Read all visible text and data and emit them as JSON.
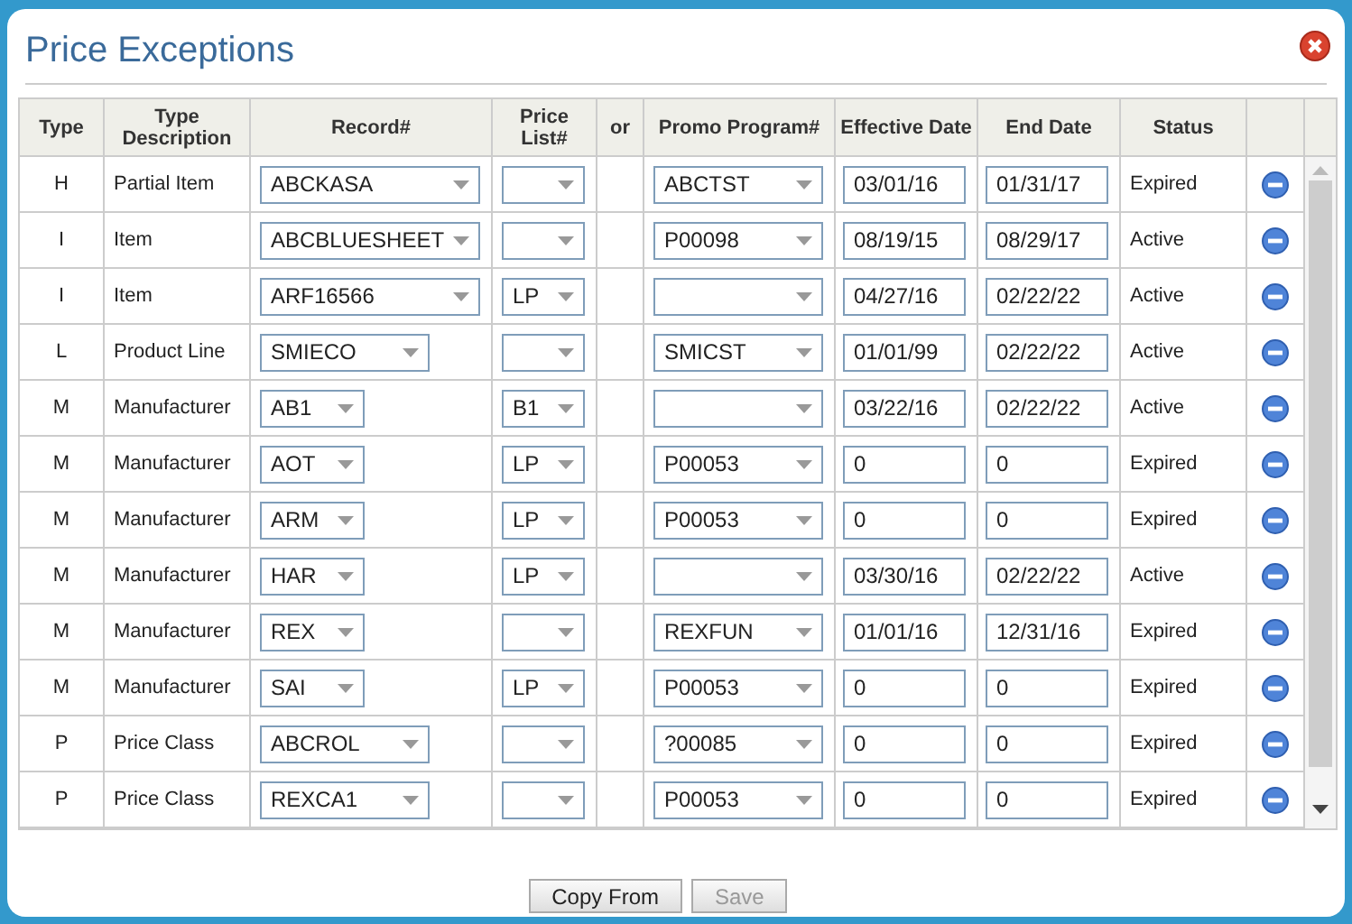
{
  "dialog": {
    "title": "Price Exceptions"
  },
  "table": {
    "columns": [
      "Type",
      "Type Description",
      "Record#",
      "Price List#",
      "or",
      "Promo Program#",
      "Effective Date",
      "End Date",
      "Status"
    ],
    "rows": [
      {
        "type": "H",
        "description": "Partial Item",
        "record": "ABCKASA",
        "promo": "ABCTST",
        "effective": "03/01/16",
        "end": "01/31/17",
        "status": "Expired"
      },
      {
        "type": "I",
        "description": "Item",
        "record": "ABCBLUESHEET",
        "promo": "P00098",
        "effective": "08/19/15",
        "end": "08/29/17",
        "status": "Active"
      },
      {
        "type": "I",
        "description": "Item",
        "record": "ARF16566",
        "price_list": "LP",
        "effective": "04/27/16",
        "end": "02/22/22",
        "status": "Active"
      },
      {
        "type": "L",
        "description": "Product Line",
        "record": "SMIECO",
        "promo": "SMICST",
        "effective": "01/01/99",
        "end": "02/22/22",
        "status": "Active"
      },
      {
        "type": "M",
        "description": "Manufacturer",
        "record": "AB1",
        "price_list": "B1",
        "effective": "03/22/16",
        "end": "02/22/22",
        "status": "Active"
      },
      {
        "type": "M",
        "description": "Manufacturer",
        "record": "AOT",
        "price_list": "LP",
        "promo": "P00053",
        "effective": "0",
        "end": "0",
        "status": "Expired"
      },
      {
        "type": "M",
        "description": "Manufacturer",
        "record": "ARM",
        "price_list": "LP",
        "promo": "P00053",
        "effective": "0",
        "end": "0",
        "status": "Expired"
      },
      {
        "type": "M",
        "description": "Manufacturer",
        "record": "HAR",
        "price_list": "LP",
        "effective": "03/30/16",
        "end": "02/22/22",
        "status": "Active"
      },
      {
        "type": "M",
        "description": "Manufacturer",
        "record": "REX",
        "promo": "REXFUN",
        "effective": "01/01/16",
        "end": "12/31/16",
        "status": "Expired"
      },
      {
        "type": "M",
        "description": "Manufacturer",
        "record": "SAI",
        "price_list": "LP",
        "promo": "P00053",
        "effective": "0",
        "end": "0",
        "status": "Expired"
      },
      {
        "type": "P",
        "description": "Price Class",
        "record": "ABCROL",
        "promo": "?00085",
        "effective": "0",
        "end": "0",
        "status": "Expired"
      },
      {
        "type": "P",
        "description": "Price Class",
        "record": "REXCA1",
        "promo": "P00053",
        "effective": "0",
        "end": "0",
        "status": "Expired"
      }
    ]
  },
  "buttons": [
    {
      "label": "Copy From",
      "disabled": false
    },
    {
      "label": "Save",
      "disabled": true
    }
  ]
}
